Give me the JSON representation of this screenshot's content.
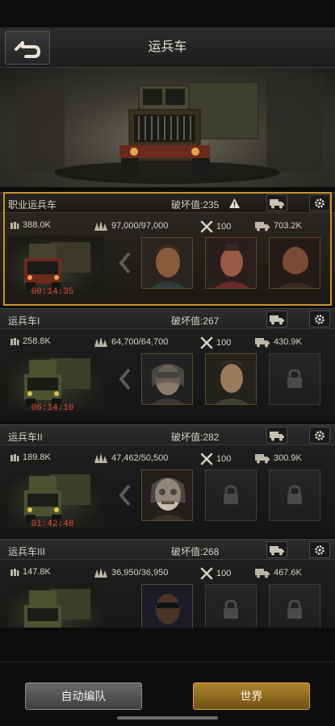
{
  "header": {
    "title": "运兵车",
    "back_icon": "back-arrow-icon"
  },
  "colors": {
    "accent_gold": "#c8922e",
    "timer_red": "#e24a3a",
    "panel": "#1e1e1e"
  },
  "trucks": [
    {
      "name": "职业运兵车",
      "damage": "破坏值:235",
      "warning": true,
      "selected": true,
      "power": "388.0K",
      "load": "97,000/97,000",
      "repair": "100",
      "capacity": "703.2K",
      "timer": "00:14:35",
      "slots": [
        {
          "state": "hero",
          "color": "#7a4a2c"
        },
        {
          "state": "hero",
          "color": "#8a3a30"
        },
        {
          "state": "hero",
          "color": "#6a3a2a"
        }
      ]
    },
    {
      "name": "运兵车I",
      "damage": "破坏值:267",
      "warning": false,
      "selected": false,
      "power": "258.8K",
      "load": "64,700/64,700",
      "repair": "100",
      "capacity": "430.9K",
      "timer": "06:14:10",
      "slots": [
        {
          "state": "hero",
          "color": "#5a5550"
        },
        {
          "state": "hero",
          "color": "#6a5a48"
        },
        {
          "state": "locked"
        }
      ]
    },
    {
      "name": "运兵车II",
      "damage": "破坏值:282",
      "warning": false,
      "selected": false,
      "power": "189.8K",
      "load": "47,462/50,500",
      "repair": "100",
      "capacity": "300.9K",
      "timer": "01:42:48",
      "slots": [
        {
          "state": "hero",
          "color": "#8a8480"
        },
        {
          "state": "locked"
        },
        {
          "state": "locked"
        }
      ]
    },
    {
      "name": "运兵车III",
      "damage": "破坏值:268",
      "warning": false,
      "selected": false,
      "power": "147.8K",
      "load": "36,950/36,950",
      "repair": "100",
      "capacity": "467.6K",
      "timer": "",
      "slots": [
        {
          "state": "hero",
          "color": "#3a2e28"
        },
        {
          "state": "locked"
        },
        {
          "state": "locked"
        }
      ]
    }
  ],
  "footer": {
    "auto_label": "自动编队",
    "world_label": "世界"
  }
}
